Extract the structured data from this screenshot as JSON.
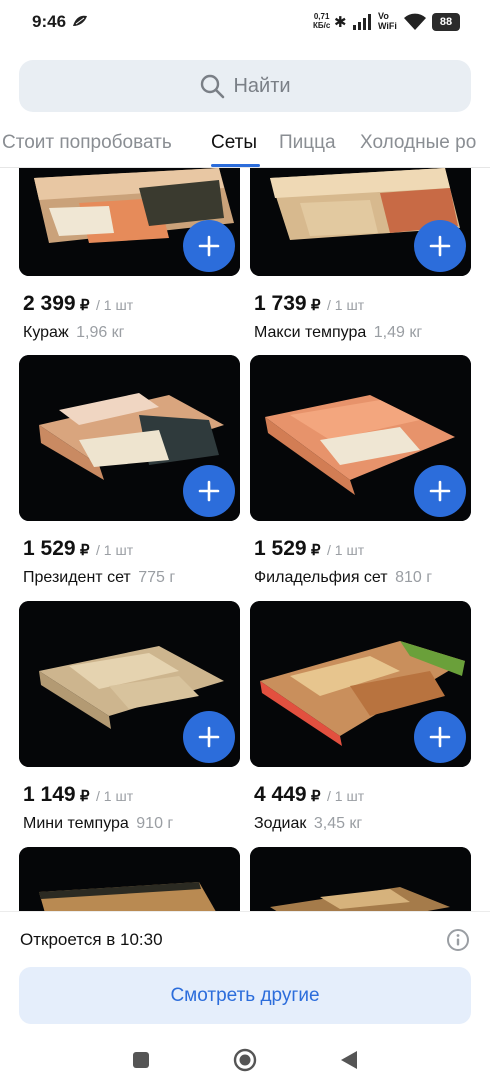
{
  "status_bar": {
    "time": "9:46",
    "net_speed_value": "0,71",
    "net_speed_unit": "КБ/с",
    "vowifi_top": "Vo",
    "vowifi_bottom": "WiFi",
    "battery": "88"
  },
  "search": {
    "label": "Найти",
    "icon": "search-icon"
  },
  "tabs": [
    {
      "label": "Стоит попробовать",
      "active": false
    },
    {
      "label": "Сеты",
      "active": true
    },
    {
      "label": "Пицца",
      "active": false
    },
    {
      "label": "Холодные ро",
      "active": false
    }
  ],
  "products": [
    {
      "price": "2 399",
      "currency": "₽",
      "unit": "/ 1 шт",
      "name": "Кураж",
      "weight": "1,96 кг"
    },
    {
      "price": "1 739",
      "currency": "₽",
      "unit": "/ 1 шт",
      "name": "Макси темпура",
      "weight": "1,49 кг"
    },
    {
      "price": "1 529",
      "currency": "₽",
      "unit": "/ 1 шт",
      "name": "Президент сет",
      "weight": "775 г"
    },
    {
      "price": "1 529",
      "currency": "₽",
      "unit": "/ 1 шт",
      "name": "Филадельфия сет",
      "weight": "810 г"
    },
    {
      "price": "1 149",
      "currency": "₽",
      "unit": "/ 1 шт",
      "name": "Мини темпура",
      "weight": "910 г"
    },
    {
      "price": "4 449",
      "currency": "₽",
      "unit": "/ 1 шт",
      "name": "Зодиак",
      "weight": "3,45 кг"
    },
    {
      "price": "",
      "currency": "",
      "unit": "",
      "name": "",
      "weight": ""
    },
    {
      "price": "",
      "currency": "",
      "unit": "",
      "name": "",
      "weight": ""
    }
  ],
  "bottom": {
    "opens_text": "Откроется в 10:30",
    "more_button": "Смотреть другие"
  },
  "colors": {
    "accent": "#2c6ddb",
    "search_bg": "#e9eef3",
    "button_bg": "#e5eefb"
  }
}
